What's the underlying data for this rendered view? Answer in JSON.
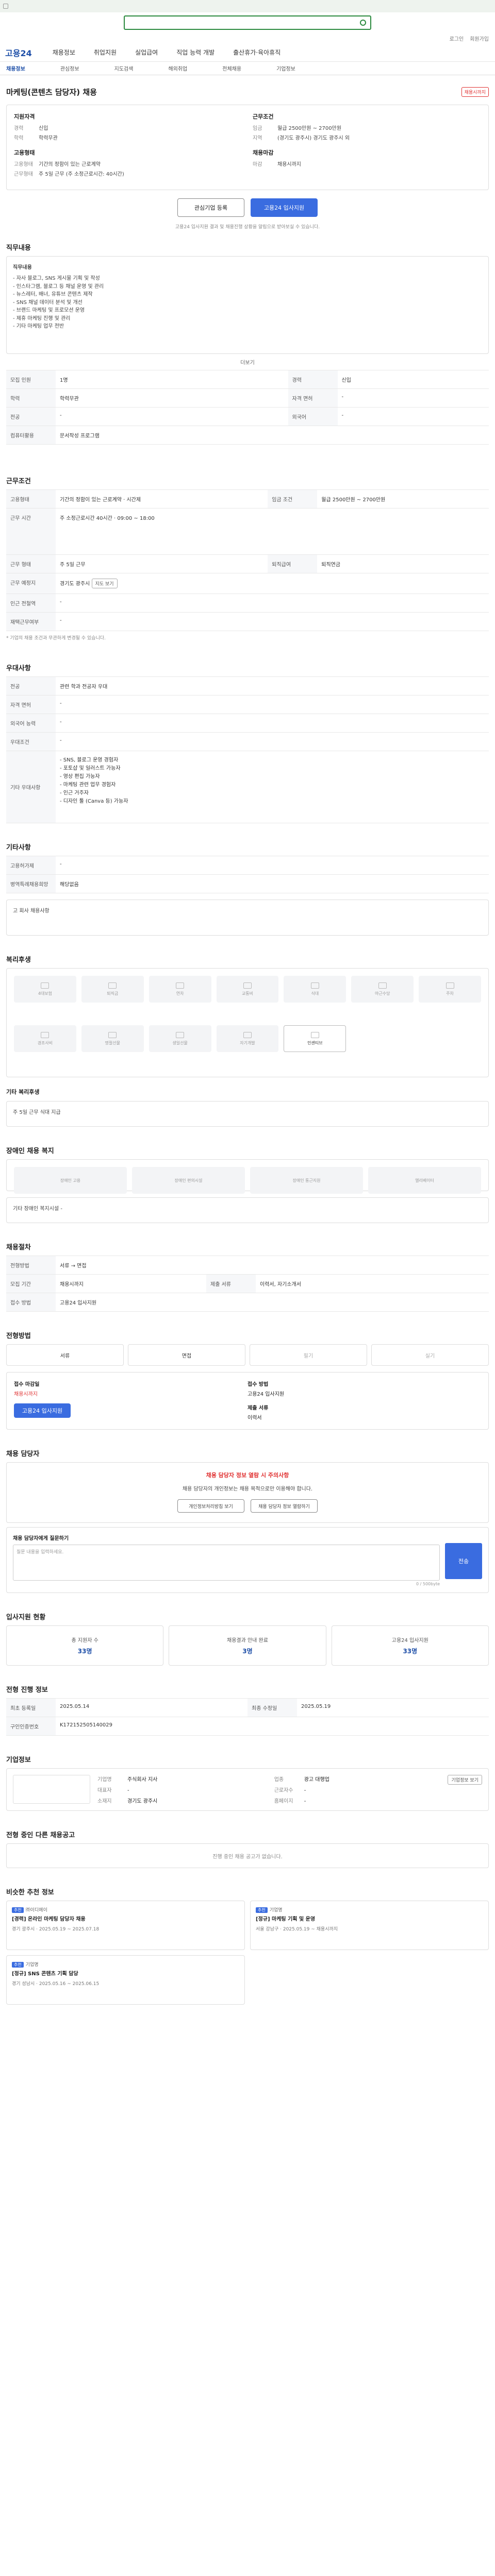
{
  "gnb": {
    "logo": "고용24",
    "menu": [
      "채용정보",
      "취업지원",
      "실업급여",
      "직업 능력 개발",
      "출산휴가·육아휴직"
    ]
  },
  "lnb": [
    "채용정보",
    "관심정보",
    "지도검색",
    "해외취업",
    "전체채용",
    "기업정보"
  ],
  "util": [
    "로그인",
    "회원가입"
  ],
  "job": {
    "title": "마케팅(콘텐츠 담당자) 채용",
    "badge": "채용시까지",
    "summary_left_label": "지원자격",
    "summary_left": [
      {
        "k": "경력",
        "v": "신입"
      },
      {
        "k": "학력",
        "v": "학력무관"
      }
    ],
    "summary_left2_label": "고용형태",
    "summary_left2": [
      {
        "k": "고용형태",
        "v": "기간의 정함이 있는 근로계약"
      },
      {
        "k": "근무형태",
        "v": "주 5일 근무 (주 소정근로시간: 40시간)"
      }
    ],
    "summary_right_label": "근무조건",
    "summary_right": [
      {
        "k": "임금",
        "v": "월급 2500만원 ~ 2700만원"
      },
      {
        "k": "지역",
        "v": "(경기도 광주시) 경기도 광주시 외"
      }
    ],
    "summary_right2_label": "채용마감",
    "summary_right2": [
      {
        "k": "마감",
        "v": "채용시까지"
      }
    ],
    "interest_btn": "관심기업 등록",
    "apply_btn": "고용24 입사지원",
    "note": "고용24 입사지원 결과 및 채용진행 상황을 알림으로 받아보실 수 있습니다."
  },
  "duty": {
    "title": "직무내용",
    "label": "직무내용",
    "items": [
      "- 자사 블로그, SNS 게시물 기획 및 작성",
      "- 인스타그램, 블로그 등 채널 운영 및 관리",
      "- 뉴스레터, 배너, 유튜브 콘텐츠 제작",
      "- SNS 채널 데이터 분석 및 개선",
      "- 브랜드 마케팅 및 프로모션 운영",
      "- 제휴 마케팅 진행 및 관리",
      "- 기타 마케팅 업무 전반"
    ],
    "more": "더보기"
  },
  "req": [
    {
      "k": "모집 인원",
      "v": "1명"
    },
    {
      "k": "경력",
      "v": "신입"
    },
    {
      "k": "학력",
      "v": "학력무관"
    },
    {
      "k": "자격 면허",
      "v": "-"
    },
    {
      "k": "전공",
      "v": "-"
    },
    {
      "k": "외국어",
      "v": "-"
    },
    {
      "k": "컴퓨터활용",
      "v": "문서작성 프로그램"
    }
  ],
  "cond": {
    "title": "근무조건",
    "rows": [
      {
        "k": "고용형태",
        "v": "기간의 정함이 있는 근로계약 · 시간제"
      },
      {
        "k": "임금 조건",
        "v": "월급 2500만원 ~ 2700만원"
      },
      {
        "k": "근무 시간",
        "v": "주 소정근로시간 40시간 · 09:00 ~ 18:00"
      },
      {
        "k": "근무 형태",
        "v": "주 5일 근무"
      },
      {
        "k": "퇴직급여",
        "v": "퇴직연금"
      },
      {
        "k": "근무 예정지",
        "v": "경기도 광주시"
      },
      {
        "k": "인근 전철역",
        "v": "-"
      },
      {
        "k": "재택근무여부",
        "v": "-"
      }
    ],
    "map_btn": "지도 보기",
    "note": "* 기업의 채용 조건과 무관하게 변경될 수 있습니다."
  },
  "pref": {
    "title": "우대사항",
    "rows": [
      {
        "k": "전공",
        "v": "관련 학과 전공자 우대"
      },
      {
        "k": "자격 면허",
        "v": "-"
      },
      {
        "k": "외국어 능력",
        "v": "-"
      },
      {
        "k": "우대조건",
        "v": "-"
      },
      {
        "k": "기타 우대사항",
        "v": "- SNS, 블로그 운영 경험자\n- 포토샵 및 일러스트 가능자\n- 영상 편집 가능자\n- 마케팅 관련 업무 경험자\n- 인근 거주자\n- 디자인 툴 (Canva 등) 가능자"
      }
    ]
  },
  "other": {
    "title": "기타사항",
    "rows": [
      {
        "k": "고용허가제",
        "v": "-"
      },
      {
        "k": "병역특례채용희망",
        "v": "해당없음"
      }
    ],
    "link": "고 회사 채용사항"
  },
  "welfare": {
    "title": "복리후생",
    "items": [
      "4대보험",
      "퇴직금",
      "연차",
      "교통비",
      "식대",
      "야근수당",
      "주차",
      "경조사비",
      "명절선물",
      "생일선물",
      "자기개발",
      "인센티브",
      "교육지원"
    ],
    "sel_title": "기타 복리후생",
    "sel_v": "주 5일 근무 식대 지급"
  },
  "disab": {
    "title": "장애인 채용 복지",
    "items": [
      "장애인 고용",
      "장애인 편의시설",
      "장애인 통근지원",
      "엘리베이터"
    ],
    "sub": "기타 장애인 복지시설",
    "sub_v": "-"
  },
  "proc": {
    "title": "채용절차",
    "rows": [
      {
        "k": "전형방법",
        "v": "서류 → 면접"
      },
      {
        "k": "모집 기간",
        "v": "채용시까지"
      },
      {
        "k": "제출 서류",
        "v": "이력서, 자기소개서"
      },
      {
        "k": "접수 방법",
        "v": "고용24 입사지원"
      }
    ]
  },
  "status": {
    "title": "전형방법",
    "items": [
      "서류",
      "면접",
      "필기",
      "실기"
    ]
  },
  "apply": {
    "l1": "접수 마감일",
    "v1": "채용시까지",
    "l2": "접수 방법",
    "v2": "고용24 입사지원",
    "btn": "고용24 입사지원",
    "l3": "제출 서류",
    "v3": "이력서"
  },
  "warn": {
    "title": "채용 담당자",
    "t": "채용 담당자 정보 열람 시 주의사항",
    "p": "채용 담당자의 개인정보는 채용 목적으로만 이용해야 합니다.",
    "b1": "개인정보처리방침 보기",
    "b2": "채용 담당자 정보 열람하기"
  },
  "form": {
    "title": "채용 담당자에게 질문하기",
    "ph": "질문 내용을 입력하세요.",
    "btn": "전송",
    "cnt": "0 / 500byte"
  },
  "stats": {
    "title": "입사지원 현황",
    "items": [
      {
        "k": "총 지원자 수",
        "v": "33명"
      },
      {
        "k": "채용결과 안내 완료",
        "v": "3명"
      },
      {
        "k": "고용24 입사지원",
        "v": "33명"
      }
    ]
  },
  "company": {
    "title": "기업정보",
    "rows": [
      {
        "k": "기업명",
        "v": "주식회사 지사"
      },
      {
        "k": "업종",
        "v": "광고 대행업"
      },
      {
        "k": "대표자",
        "v": "-"
      },
      {
        "k": "근로자수",
        "v": "-"
      },
      {
        "k": "소재지",
        "v": "경기도 광주시"
      },
      {
        "k": "홈페이지",
        "v": "-"
      }
    ],
    "btn": "기업정보 보기"
  },
  "info": {
    "title": "전형 진행 정보",
    "rows": [
      {
        "k": "최초 등록일",
        "v": "2025.05.14"
      },
      {
        "k": "최종 수정일",
        "v": "2025.05.19"
      },
      {
        "k": "구인인증번호",
        "v": "K172152505140029"
      }
    ]
  },
  "same": {
    "title": "전형 중인 다른 채용공고",
    "empty": "진행 중인 채용 공고가 없습니다."
  },
  "recs": {
    "title": "비슷한 추천 정보",
    "items": [
      {
        "co": "㈜이디에이",
        "tag": "추천",
        "tt": "[경력] 온라인 마케팅 담당자 채용",
        "mt": "경기 광주시 · 2025.05.19 ~ 2025.07.18"
      },
      {
        "co": "기업명",
        "tag": "추천",
        "tt": "[정규] 마케팅 기획 및 운영",
        "mt": "서울 강남구 · 2025.05.19 ~ 채용시까지"
      },
      {
        "co": "기업명",
        "tag": "추천",
        "tt": "[정규] SNS 콘텐츠 기획 담당",
        "mt": "경기 성남시 · 2025.05.16 ~ 2025.06.15"
      }
    ]
  }
}
